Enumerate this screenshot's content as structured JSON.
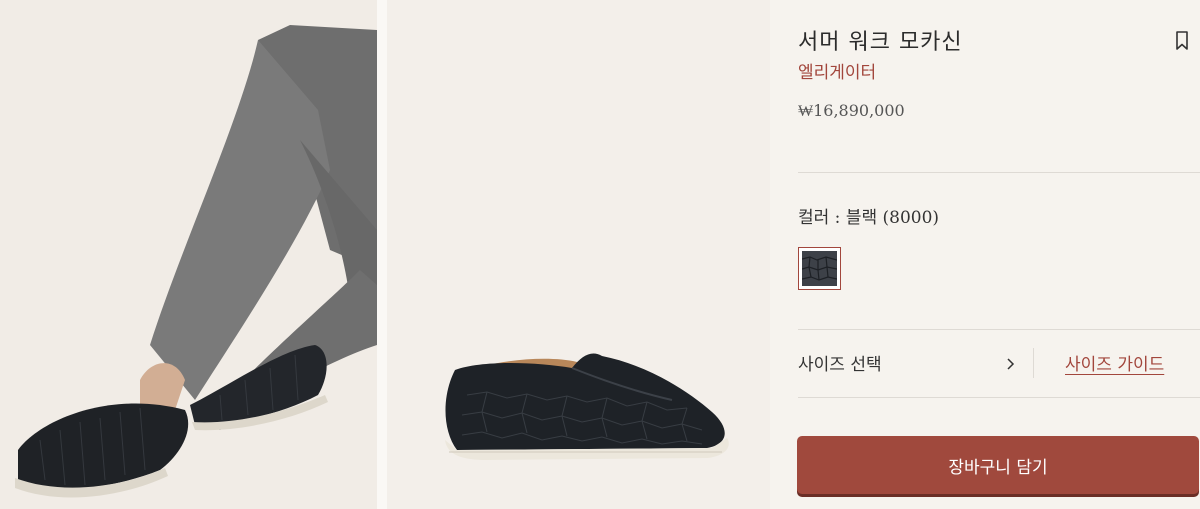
{
  "product": {
    "title": "서머 워크 모카신",
    "brand": "엘리게이터",
    "price": "₩16,890,000"
  },
  "options": {
    "color_label": "컬러 : 블랙 (8000)",
    "size_label": "사이즈 선택",
    "size_guide": "사이즈 가이드"
  },
  "actions": {
    "add_to_cart": "장바구니 담기"
  },
  "icons": {
    "bookmark": "bookmark-icon",
    "chevron": "chevron-right-icon"
  },
  "colors": {
    "accent": "#a2463c",
    "button": "#a0493d",
    "background": "#f6f3ee"
  }
}
